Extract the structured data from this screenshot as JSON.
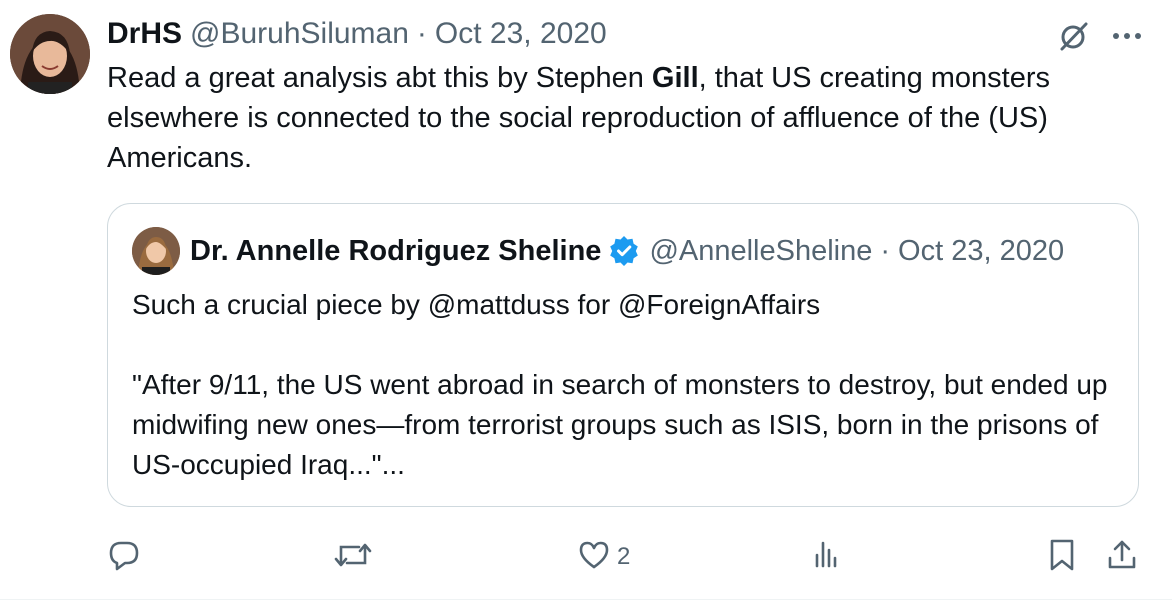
{
  "tweet": {
    "author_name": "DrHS",
    "handle": "@BuruhSiluman",
    "separator": "·",
    "date": "Oct 23, 2020",
    "text_before": "Read a great analysis abt this by Stephen ",
    "text_bold": "Gill",
    "text_after": ", that US creating monsters elsewhere is connected to the social reproduction of affluence of the (US) Americans."
  },
  "quote": {
    "author_name": "Dr. Annelle Rodriguez Sheline",
    "handle": "@AnnelleSheline",
    "separator": "·",
    "date": "Oct 23, 2020",
    "text": "Such a crucial piece by @mattduss for @ForeignAffairs\n\n\"After 9/11, the US went abroad in search of monsters to destroy, but ended up midwifing new ones—from terrorist groups such as ISIS, born in the prisons of US-occupied Iraq...\"..."
  },
  "actions": {
    "reply_count": "",
    "retweet_count": "",
    "like_count": "2",
    "views_count": ""
  },
  "icons": {
    "top_actions": [
      "grok-icon",
      "more-icon"
    ],
    "bottom_actions": [
      "reply-icon",
      "retweet-icon",
      "like-icon",
      "views-icon",
      "bookmark-icon",
      "share-icon"
    ],
    "verified": "verified-badge-icon"
  },
  "colors": {
    "text": "#0f1419",
    "secondary": "#536471",
    "border": "#cfd9de",
    "verified": "#1d9bf0"
  }
}
